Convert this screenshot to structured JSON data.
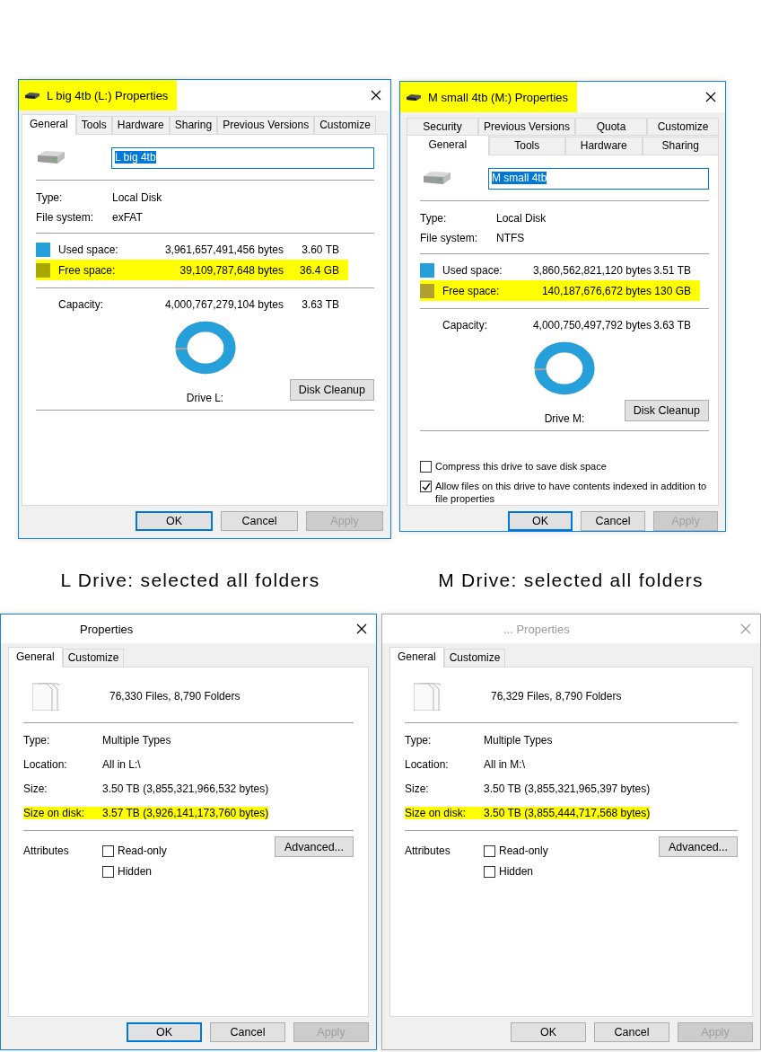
{
  "drive_dialogs": [
    {
      "title": "L big 4tb (L:) Properties",
      "title_highlighted": true,
      "active": true,
      "tab_rows": [
        [
          {
            "label": "General",
            "selected": true
          },
          {
            "label": "Tools",
            "selected": false
          },
          {
            "label": "Hardware",
            "selected": false
          },
          {
            "label": "Sharing",
            "selected": false
          },
          {
            "label": "Previous Versions",
            "selected": false
          },
          {
            "label": "Customize",
            "selected": false
          }
        ]
      ],
      "name_value": "L big 4tb",
      "info": [
        {
          "label": "Type:",
          "value": "Local Disk"
        },
        {
          "label": "File system:",
          "value": "exFAT"
        }
      ],
      "space": [
        {
          "label": "Used space:",
          "bytes": "3,961,657,491,456 bytes",
          "size": "3.60 TB",
          "color": "#26a0da",
          "highlighted": false
        },
        {
          "label": "Free space:",
          "bytes": "39,109,787,648 bytes",
          "size": "36.4 GB",
          "color": "#a8a800",
          "highlighted": true
        }
      ],
      "capacity": {
        "label": "Capacity:",
        "bytes": "4,000,767,279,104 bytes",
        "size": "3.63 TB"
      },
      "drive_label": "Drive L:",
      "cleanup_button": "Disk Cleanup",
      "buttons": [
        {
          "label": "OK",
          "focused": true,
          "disabled": false
        },
        {
          "label": "Cancel",
          "focused": false,
          "disabled": false
        },
        {
          "label": "Apply",
          "focused": false,
          "disabled": true
        }
      ]
    },
    {
      "title": "M small 4tb (M:) Properties",
      "title_highlighted": true,
      "active": true,
      "tab_rows": [
        [
          {
            "label": "Security",
            "selected": false
          },
          {
            "label": "Previous Versions",
            "selected": false
          },
          {
            "label": "Quota",
            "selected": false
          },
          {
            "label": "Customize",
            "selected": false
          }
        ],
        [
          {
            "label": "General",
            "selected": true
          },
          {
            "label": "Tools",
            "selected": false
          },
          {
            "label": "Hardware",
            "selected": false
          },
          {
            "label": "Sharing",
            "selected": false
          }
        ]
      ],
      "name_value": "M small 4tb",
      "info": [
        {
          "label": "Type:",
          "value": "Local Disk"
        },
        {
          "label": "File system:",
          "value": "NTFS"
        }
      ],
      "space": [
        {
          "label": "Used space:",
          "bytes": "3,860,562,821,120 bytes",
          "size": "3.51 TB",
          "color": "#26a0da",
          "highlighted": false
        },
        {
          "label": "Free space:",
          "bytes": "140,187,676,672 bytes",
          "size": "130 GB",
          "color": "#b0a030",
          "highlighted": true
        }
      ],
      "capacity": {
        "label": "Capacity:",
        "bytes": "4,000,750,497,792 bytes",
        "size": "3.63 TB"
      },
      "drive_label": "Drive M:",
      "cleanup_button": "Disk Cleanup",
      "checkboxes": [
        {
          "label": "Compress this drive to save disk space",
          "checked": false
        },
        {
          "label": "Allow files on this drive to have contents indexed in addition to file properties",
          "checked": true
        }
      ],
      "buttons": [
        {
          "label": "OK",
          "focused": true,
          "disabled": false
        },
        {
          "label": "Cancel",
          "focused": false,
          "disabled": false
        },
        {
          "label": "Apply",
          "focused": false,
          "disabled": true
        }
      ]
    }
  ],
  "captions": [
    "L Drive: selected all folders",
    "M Drive: selected all folders"
  ],
  "folder_dialogs": [
    {
      "title": "Properties",
      "active": true,
      "tabs": [
        {
          "label": "General",
          "selected": true
        },
        {
          "label": "Customize",
          "selected": false
        }
      ],
      "summary": "76,330 Files, 8,790 Folders",
      "rows": [
        {
          "label": "Type:",
          "value": "Multiple Types",
          "highlighted": false
        },
        {
          "label": "Location:",
          "value": "All in L:\\",
          "highlighted": false
        },
        {
          "label": "Size:",
          "value": "3.50 TB (3,855,321,966,532 bytes)",
          "highlighted": false
        },
        {
          "label": "Size on disk:",
          "value": "3.57 TB (3,926,141,173,760 bytes)",
          "highlighted": true
        }
      ],
      "attributes_label": "Attributes",
      "checkboxes": [
        {
          "label": "Read-only",
          "checked": false
        },
        {
          "label": "Hidden",
          "checked": false
        }
      ],
      "advanced_button": "Advanced...",
      "buttons": [
        {
          "label": "OK",
          "focused": true,
          "disabled": false
        },
        {
          "label": "Cancel",
          "focused": false,
          "disabled": false
        },
        {
          "label": "Apply",
          "focused": false,
          "disabled": true
        }
      ]
    },
    {
      "title": "... Properties",
      "active": false,
      "tabs": [
        {
          "label": "General",
          "selected": true
        },
        {
          "label": "Customize",
          "selected": false
        }
      ],
      "summary": "76,329 Files, 8,790 Folders",
      "rows": [
        {
          "label": "Type:",
          "value": "Multiple Types",
          "highlighted": false
        },
        {
          "label": "Location:",
          "value": "All in M:\\",
          "highlighted": false
        },
        {
          "label": "Size:",
          "value": "3.50 TB (3,855,321,965,397 bytes)",
          "highlighted": false
        },
        {
          "label": "Size on disk:",
          "value": "3.50 TB (3,855,444,717,568 bytes)",
          "highlighted": true
        }
      ],
      "attributes_label": "Attributes",
      "checkboxes": [
        {
          "label": "Read-only",
          "checked": false
        },
        {
          "label": "Hidden",
          "checked": false
        }
      ],
      "advanced_button": "Advanced...",
      "buttons": [
        {
          "label": "OK",
          "focused": false,
          "disabled": false
        },
        {
          "label": "Cancel",
          "focused": false,
          "disabled": false
        },
        {
          "label": "Apply",
          "focused": false,
          "disabled": true
        }
      ]
    }
  ]
}
